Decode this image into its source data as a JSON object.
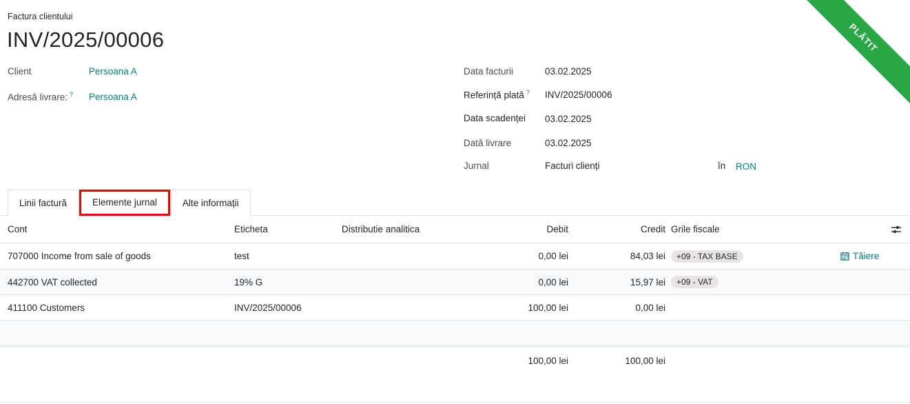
{
  "status_ribbon": "PLĂTIT",
  "doc_type": "Factura clientului",
  "doc_number": "INV/2025/00006",
  "left_fields": {
    "client_label": "Client",
    "client_value": "Persoana A",
    "delivery_label": "Adresă livrare:",
    "delivery_help": "?",
    "delivery_value": "Persoana A"
  },
  "right_fields": {
    "invoice_date_label": "Data facturii",
    "invoice_date_value": "03.02.2025",
    "payment_ref_label": "Referință plată",
    "payment_ref_help": "?",
    "payment_ref_value": "INV/2025/00006",
    "due_date_label": "Data scadenței",
    "due_date_value": "03.02.2025",
    "delivery_date_label": "Dată livrare",
    "delivery_date_value": "03.02.2025",
    "journal_label": "Jurnal",
    "journal_value": "Facturi clienți",
    "currency_in": "în",
    "currency_value": "RON"
  },
  "tabs": [
    {
      "label": "Linii factură"
    },
    {
      "label": "Elemente jurnal"
    },
    {
      "label": "Alte informații"
    }
  ],
  "table": {
    "headers": {
      "account": "Cont",
      "label": "Eticheta",
      "analytic": "Distributie analitica",
      "debit": "Debit",
      "credit": "Credit",
      "tax_grids": "Grile fiscale"
    },
    "rows": [
      {
        "account": "707000 Income from sale of goods",
        "label": "test",
        "debit": "0,00 lei",
        "credit": "84,03 lei",
        "tax_grid": "+09 - TAX BASE",
        "action": "Tăiere"
      },
      {
        "account": "442700 VAT collected",
        "label": "19% G",
        "debit": "0,00 lei",
        "credit": "15,97 lei",
        "tax_grid": "+09 - VAT",
        "action": ""
      },
      {
        "account": "411100 Customers",
        "label": "INV/2025/00006",
        "debit": "100,00 lei",
        "credit": "0,00 lei",
        "tax_grid": "",
        "action": ""
      }
    ],
    "totals": {
      "debit": "100,00 lei",
      "credit": "100,00 lei"
    }
  },
  "colors": {
    "accent": "#017e84",
    "ribbon": "#28a745",
    "active_tab_border": "#ee0000"
  }
}
